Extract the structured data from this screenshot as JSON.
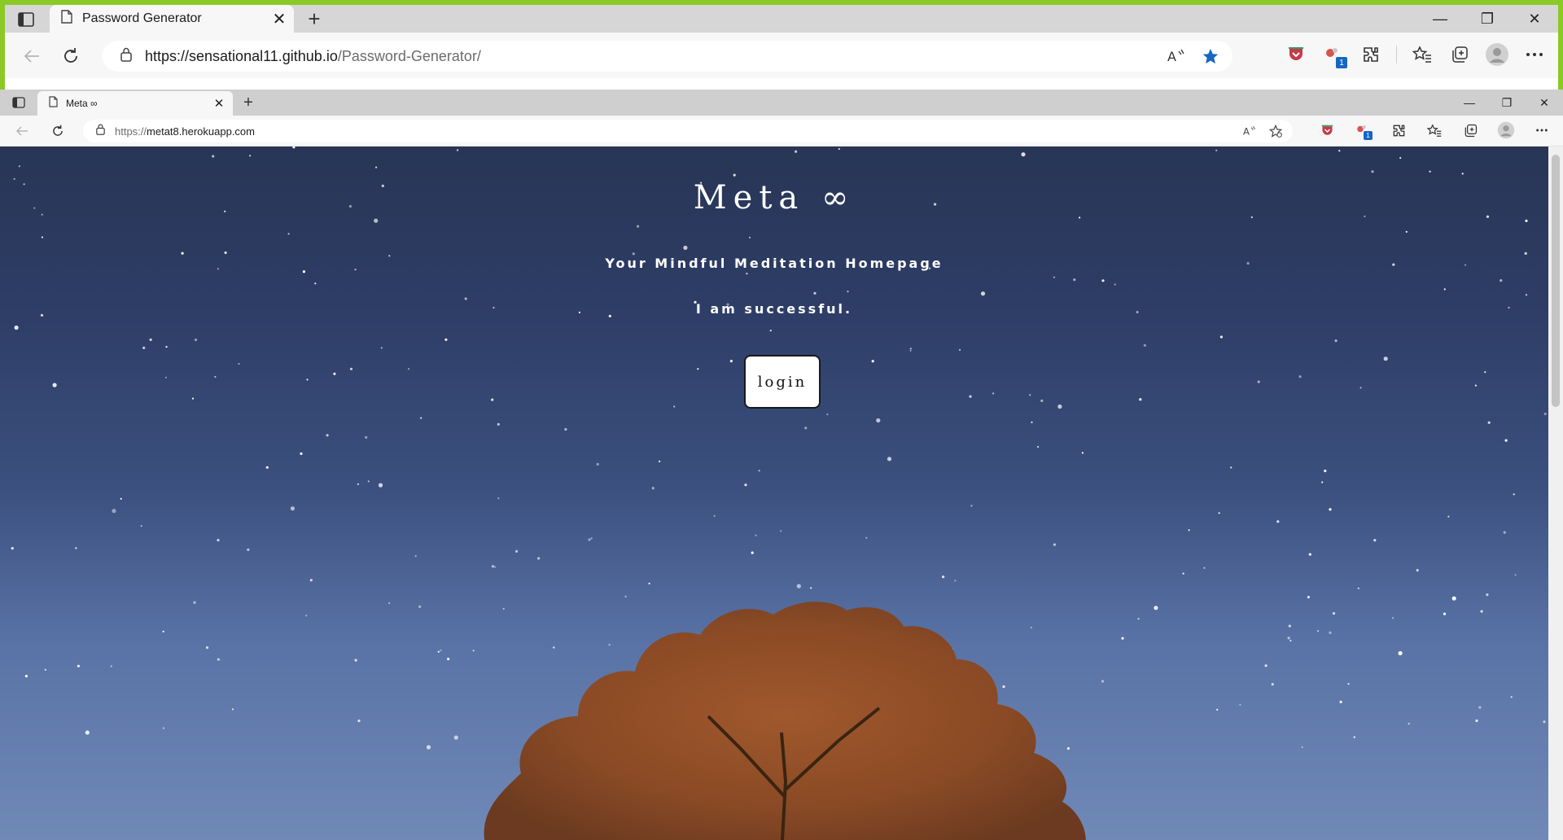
{
  "outer_browser": {
    "tab": {
      "title": "Password Generator",
      "close_glyph": "✕"
    },
    "new_tab_glyph": "+",
    "window_controls": {
      "minimize": "—",
      "restore": "❐",
      "close": "✕"
    },
    "address": {
      "host_part": "https://sensational11.github.io",
      "path_part": "/Password-Generator/"
    },
    "toolbar_icons": [
      "read-aloud-icon",
      "favorite-star-icon",
      "pocket-extension-icon",
      "badge-extension-icon",
      "extensions-icon",
      "favorites-icon",
      "collections-icon",
      "profile-avatar-icon",
      "more-menu-icon"
    ],
    "extension_badge": "1",
    "accent_color": "#8ac926"
  },
  "inner_browser": {
    "tab": {
      "title": "Meta ∞",
      "close_glyph": "✕"
    },
    "new_tab_glyph": "+",
    "window_controls": {
      "minimize": "—",
      "restore": "❐",
      "close": "✕"
    },
    "address": {
      "scheme_part": "https://",
      "host_part": "metat8.herokuapp.com"
    },
    "extension_badge": "1"
  },
  "page": {
    "title": "Meta ∞",
    "tagline": "Your Mindful Meditation Homepage",
    "affirmation": "I am successful.",
    "login_label": "login",
    "sky_color_top": "#283556",
    "sky_color_bottom": "#7089b7",
    "tree_color": "#8a4a25"
  }
}
